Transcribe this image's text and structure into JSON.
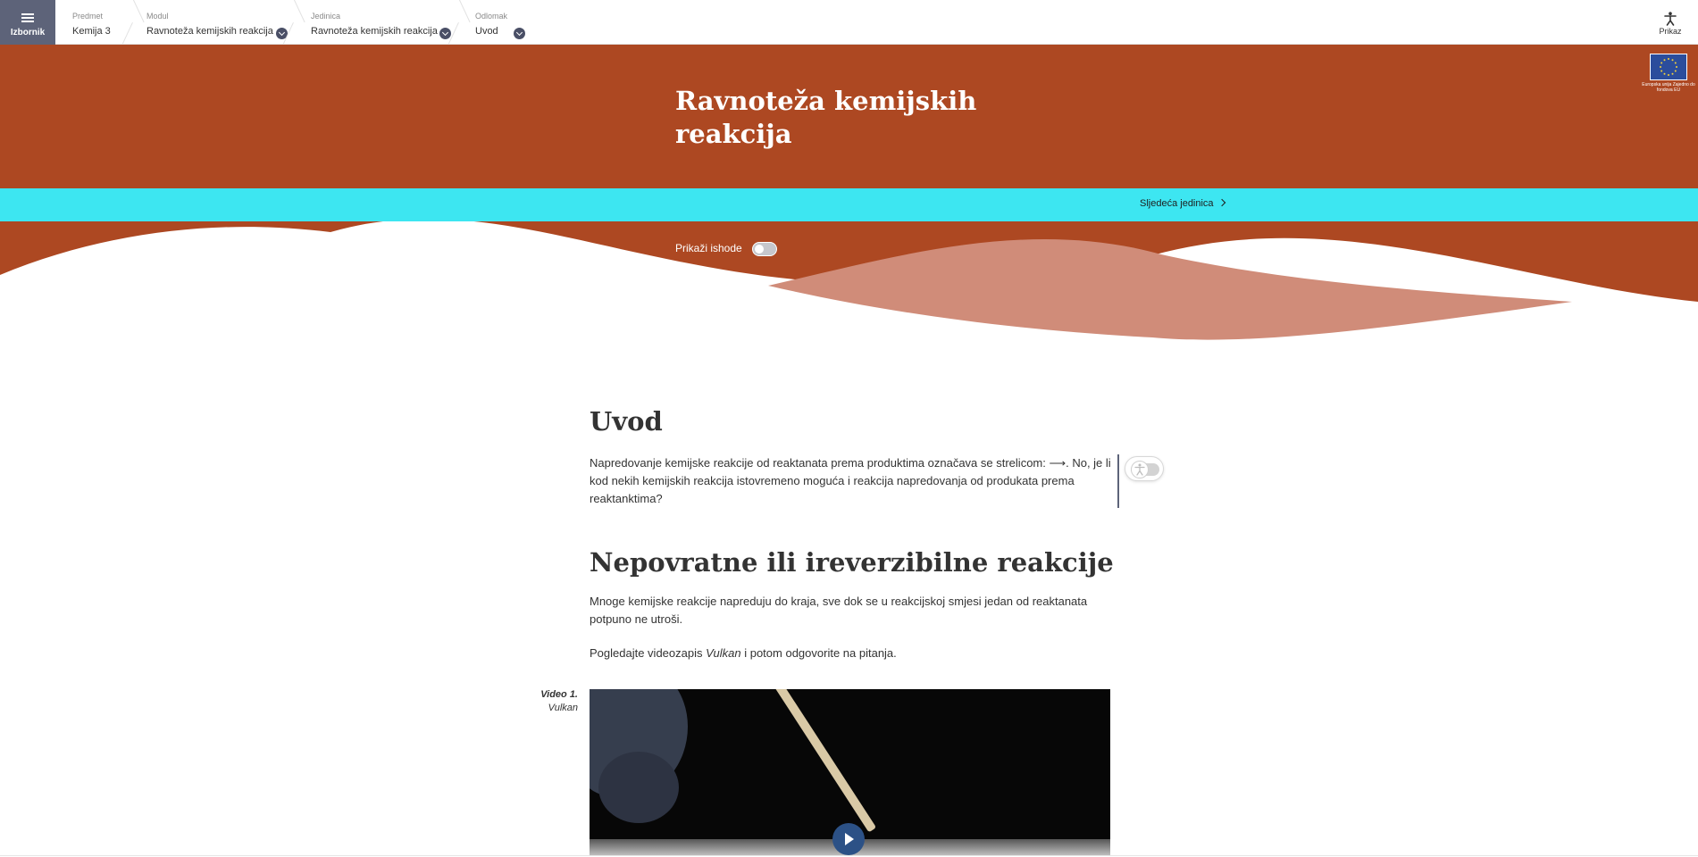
{
  "topbar": {
    "menu_label": "Izbornik",
    "breadcrumbs": [
      {
        "caption": "Predmet",
        "value": "Kemija 3"
      },
      {
        "caption": "Modul",
        "value": "Ravnoteža kemijskih reakcija"
      },
      {
        "caption": "Jedinica",
        "value": "Ravnoteža kemijskih reakcija"
      },
      {
        "caption": "Odlomak",
        "value": "Uvod"
      }
    ],
    "display_label": "Prikaz"
  },
  "hero": {
    "title_line1": "Ravnoteža kemijskih",
    "title_line2": "reakcija",
    "eu_text": "Europska unija Zajedno do fondova EU",
    "next_unit": "Sljedeća jedinica",
    "show_outcomes": "Prikaži ishode"
  },
  "content": {
    "intro_heading": "Uvod",
    "intro_text": "Napredovanje kemijske reakcije od reaktanata prema produktima označava se strelicom: ⟶. No, je li kod nekih kemijskih reakcija istovremeno moguća i reakcija napredovanja od produkata prema reaktanktima?",
    "section_heading": "Nepovratne ili ireverzibilne reakcije",
    "section_text": "Mnoge kemijske reakcije napreduju do kraja, sve dok se u reakcijskoj smjesi jedan od reaktanata potpuno ne utroši.",
    "watch_prefix": "Pogledajte videozapis ",
    "watch_title": "Vulkan",
    "watch_suffix": " i potom odgovorite na pitanja.",
    "video_number": "Video 1.",
    "video_name": "Vulkan"
  },
  "colors": {
    "hero": "#ad4822",
    "nextbar": "#3de6f1",
    "wave_light": "#d08c79",
    "menu": "#5d6379"
  },
  "icons": {
    "menu": "hamburger-icon",
    "display": "accessibility-person-icon",
    "chevron": "chevron-down-icon",
    "next": "chevron-right-icon",
    "play": "play-icon"
  }
}
